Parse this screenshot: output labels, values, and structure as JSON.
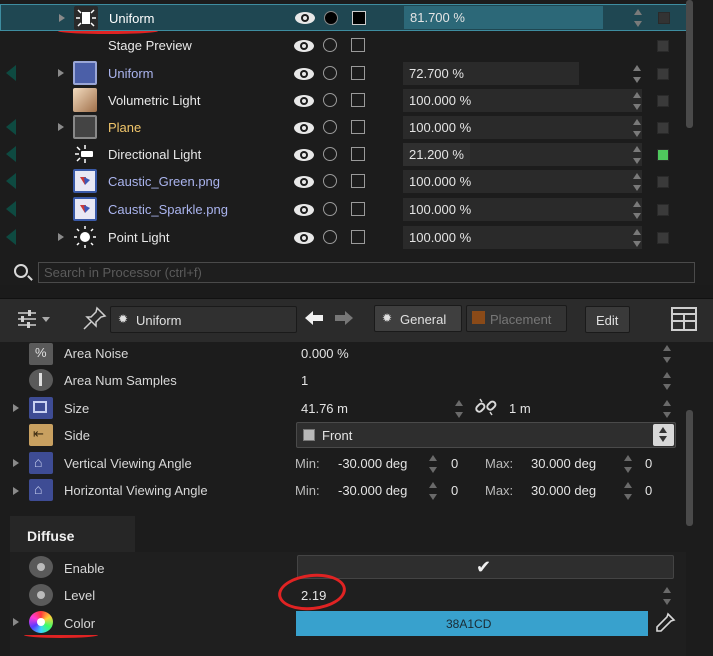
{
  "tree": {
    "rows": [
      {
        "name": "Uniform",
        "opacity": "81.700 %",
        "opacity_fill": 0.82,
        "selected": true
      },
      {
        "name": "Stage Preview",
        "opacity": "",
        "opacity_fill": 0
      },
      {
        "name": "Uniform",
        "opacity": "72.700 %",
        "opacity_fill": 0.727
      },
      {
        "name": "Volumetric Light",
        "opacity": "100.000 %",
        "opacity_fill": 1
      },
      {
        "name": "Plane",
        "opacity": "100.000 %",
        "opacity_fill": 1
      },
      {
        "name": "Directional Light",
        "opacity": "21.200 %",
        "opacity_fill": 0.212,
        "enabled_green": true
      },
      {
        "name": "Caustic_Green.png",
        "opacity": "100.000 %",
        "opacity_fill": 1
      },
      {
        "name": "Caustic_Sparkle.png",
        "opacity": "100.000 %",
        "opacity_fill": 1
      },
      {
        "name": "Point Light",
        "opacity": "100.000 %",
        "opacity_fill": 1
      }
    ]
  },
  "search": {
    "placeholder": "Search in Processor (ctrl+f)"
  },
  "toolbar": {
    "node_name": "Uniform",
    "tab_general": "General",
    "tab_placement": "Placement",
    "edit_label": "Edit"
  },
  "properties": {
    "area_noise": {
      "label": "Area Noise",
      "value": "0.000 %"
    },
    "area_num_samples": {
      "label": "Area Num Samples",
      "value": "1"
    },
    "size": {
      "label": "Size",
      "value": "41.76 m",
      "link_value": "1 m"
    },
    "side": {
      "label": "Side",
      "value": "Front"
    },
    "vertical_viewing_angle": {
      "label": "Vertical Viewing Angle",
      "min_label": "Min:",
      "min_value": "-30.000 deg",
      "min_extra": "0",
      "max_label": "Max:",
      "max_value": "30.000 deg",
      "max_extra": "0"
    },
    "horizontal_viewing_angle": {
      "label": "Horizontal Viewing Angle",
      "min_label": "Min:",
      "min_value": "-30.000 deg",
      "min_extra": "0",
      "max_label": "Max:",
      "max_value": "30.000 deg",
      "max_extra": "0"
    }
  },
  "diffuse": {
    "section_title": "Diffuse",
    "enable_label": "Enable",
    "enable_checked": "✔",
    "level_label": "Level",
    "level_value": "2.19",
    "color_label": "Color",
    "color_hex": "38A1CD",
    "color_swatch": "#38A1CD"
  },
  "colors": {
    "selection_bg": "#1f4752",
    "accent_green": "#4fc85d",
    "annotation_red": "#e02323"
  }
}
